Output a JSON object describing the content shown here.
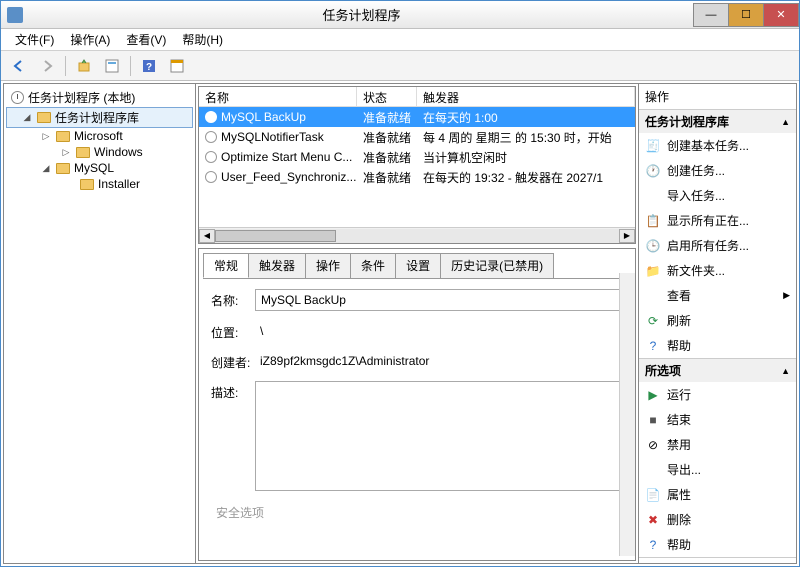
{
  "window": {
    "title": "任务计划程序"
  },
  "menu": {
    "file": "文件(F)",
    "operation": "操作(A)",
    "view": "查看(V)",
    "help": "帮助(H)"
  },
  "tree": {
    "root": "任务计划程序 (本地)",
    "lib": "任务计划程序库",
    "microsoft": "Microsoft",
    "windows": "Windows",
    "mysql": "MySQL",
    "installer": "Installer"
  },
  "columns": {
    "name": "名称",
    "status": "状态",
    "trigger": "触发器"
  },
  "tasks": [
    {
      "name": "MySQL BackUp",
      "status": "准备就绪",
      "trigger": "在每天的 1:00"
    },
    {
      "name": "MySQLNotifierTask",
      "status": "准备就绪",
      "trigger": "每 4 周的 星期三 的 15:30 时，开始"
    },
    {
      "name": "Optimize Start Menu C...",
      "status": "准备就绪",
      "trigger": "当计算机空闲时"
    },
    {
      "name": "User_Feed_Synchroniz...",
      "status": "准备就绪",
      "trigger": "在每天的 19:32 - 触发器在 2027/1"
    }
  ],
  "tabs": {
    "general": "常规",
    "triggers": "触发器",
    "actions": "操作",
    "conditions": "条件",
    "settings": "设置",
    "history": "历史记录(已禁用)"
  },
  "general": {
    "name_label": "名称:",
    "name_value": "MySQL BackUp",
    "location_label": "位置:",
    "location_value": "\\",
    "author_label": "创建者:",
    "author_value": "iZ89pf2kmsgdc1Z\\Administrator",
    "desc_label": "描述:",
    "security_label": "安全选项"
  },
  "actions": {
    "header": "操作",
    "section1": "任务计划程序库",
    "section2": "所选项",
    "items1": {
      "create_basic": "创建基本任务...",
      "create": "创建任务...",
      "import": "导入任务...",
      "show_running": "显示所有正在...",
      "enable_all": "启用所有任务...",
      "new_folder": "新文件夹...",
      "view": "查看",
      "refresh": "刷新",
      "help": "帮助"
    },
    "items2": {
      "run": "运行",
      "end": "结束",
      "disable": "禁用",
      "export": "导出...",
      "properties": "属性",
      "delete": "删除",
      "help2": "帮助"
    }
  }
}
